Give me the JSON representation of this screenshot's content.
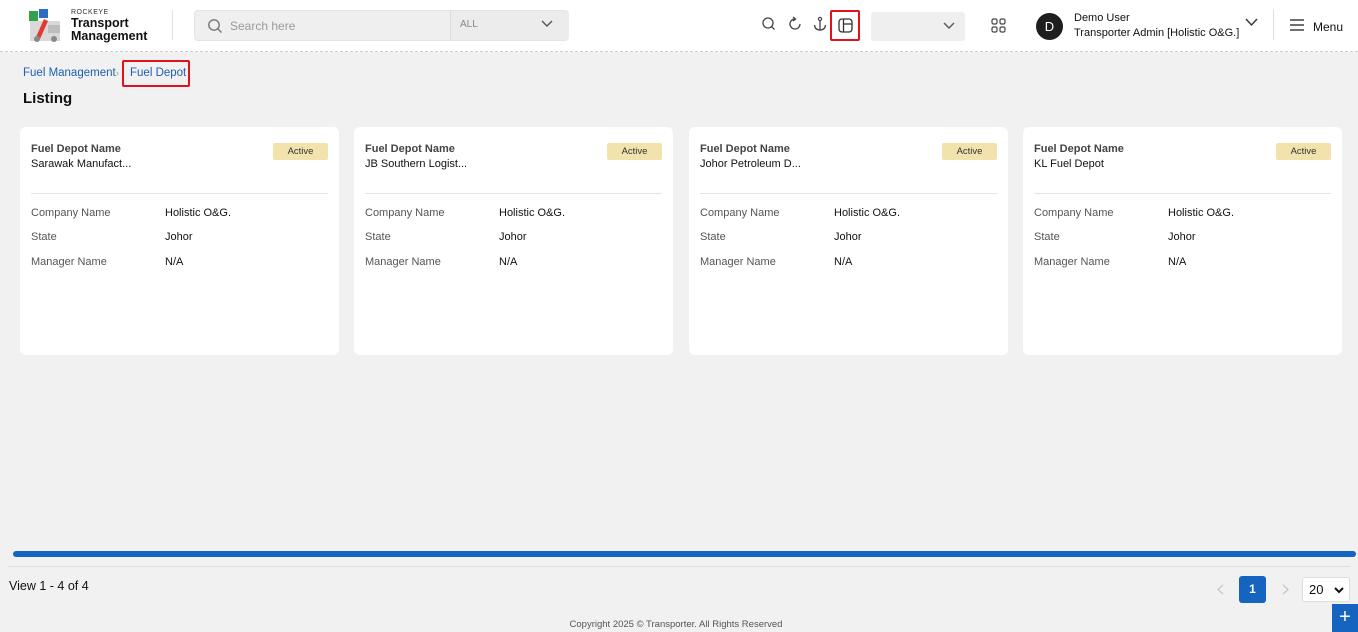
{
  "header": {
    "brand_small": "ROCKEYE",
    "brand_line1": "Transport",
    "brand_line2": "Management",
    "search_placeholder": "Search here",
    "search_scope": "ALL",
    "user_name": "Demo User",
    "user_role": "Transporter Admin [Holistic O&G.]",
    "avatar_initial": "D",
    "menu_label": "Menu"
  },
  "breadcrumb": {
    "parent": "Fuel Management",
    "separator": "›",
    "current": "Fuel Depot"
  },
  "page_title": "Listing",
  "field_labels": {
    "depot_name": "Fuel Depot Name",
    "company": "Company Name",
    "state": "State",
    "manager": "Manager Name"
  },
  "cards": [
    {
      "name": "Sarawak Manufact...",
      "status": "Active",
      "company": "Holistic O&G.",
      "state": "Johor",
      "manager": "N/A"
    },
    {
      "name": "JB Southern Logist...",
      "status": "Active",
      "company": "Holistic O&G.",
      "state": "Johor",
      "manager": "N/A"
    },
    {
      "name": "Johor Petroleum D...",
      "status": "Active",
      "company": "Holistic O&G.",
      "state": "Johor",
      "manager": "N/A"
    },
    {
      "name": "KL Fuel Depot",
      "status": "Active",
      "company": "Holistic O&G.",
      "state": "Johor",
      "manager": "N/A"
    }
  ],
  "footer": {
    "view_text": "View 1 - 4 of 4",
    "current_page": "1",
    "page_size": "20",
    "copyright": "Copyright 2025 © Transporter. All Rights Reserved",
    "fab_label": "+"
  },
  "colors": {
    "accent": "#1565c0",
    "link": "#1d5fae",
    "highlight": "#e0121b",
    "badge": "#f2e3ad"
  }
}
